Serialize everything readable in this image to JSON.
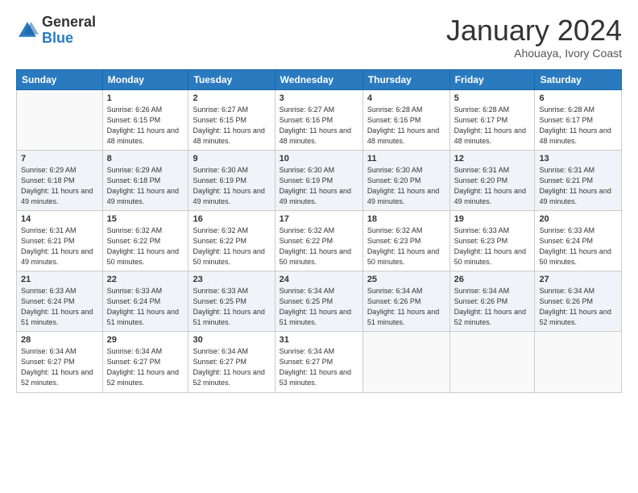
{
  "logo": {
    "general": "General",
    "blue": "Blue"
  },
  "title": "January 2024",
  "subtitle": "Ahouaya, Ivory Coast",
  "weekdays": [
    "Sunday",
    "Monday",
    "Tuesday",
    "Wednesday",
    "Thursday",
    "Friday",
    "Saturday"
  ],
  "weeks": [
    [
      {
        "day": null
      },
      {
        "day": "1",
        "sunrise": "6:26 AM",
        "sunset": "6:15 PM",
        "daylight": "11 hours and 48 minutes."
      },
      {
        "day": "2",
        "sunrise": "6:27 AM",
        "sunset": "6:15 PM",
        "daylight": "11 hours and 48 minutes."
      },
      {
        "day": "3",
        "sunrise": "6:27 AM",
        "sunset": "6:16 PM",
        "daylight": "11 hours and 48 minutes."
      },
      {
        "day": "4",
        "sunrise": "6:28 AM",
        "sunset": "6:16 PM",
        "daylight": "11 hours and 48 minutes."
      },
      {
        "day": "5",
        "sunrise": "6:28 AM",
        "sunset": "6:17 PM",
        "daylight": "11 hours and 48 minutes."
      },
      {
        "day": "6",
        "sunrise": "6:28 AM",
        "sunset": "6:17 PM",
        "daylight": "11 hours and 48 minutes."
      }
    ],
    [
      {
        "day": "7",
        "sunrise": "6:29 AM",
        "sunset": "6:18 PM",
        "daylight": "11 hours and 49 minutes."
      },
      {
        "day": "8",
        "sunrise": "6:29 AM",
        "sunset": "6:18 PM",
        "daylight": "11 hours and 49 minutes."
      },
      {
        "day": "9",
        "sunrise": "6:30 AM",
        "sunset": "6:19 PM",
        "daylight": "11 hours and 49 minutes."
      },
      {
        "day": "10",
        "sunrise": "6:30 AM",
        "sunset": "6:19 PM",
        "daylight": "11 hours and 49 minutes."
      },
      {
        "day": "11",
        "sunrise": "6:30 AM",
        "sunset": "6:20 PM",
        "daylight": "11 hours and 49 minutes."
      },
      {
        "day": "12",
        "sunrise": "6:31 AM",
        "sunset": "6:20 PM",
        "daylight": "11 hours and 49 minutes."
      },
      {
        "day": "13",
        "sunrise": "6:31 AM",
        "sunset": "6:21 PM",
        "daylight": "11 hours and 49 minutes."
      }
    ],
    [
      {
        "day": "14",
        "sunrise": "6:31 AM",
        "sunset": "6:21 PM",
        "daylight": "11 hours and 49 minutes."
      },
      {
        "day": "15",
        "sunrise": "6:32 AM",
        "sunset": "6:22 PM",
        "daylight": "11 hours and 50 minutes."
      },
      {
        "day": "16",
        "sunrise": "6:32 AM",
        "sunset": "6:22 PM",
        "daylight": "11 hours and 50 minutes."
      },
      {
        "day": "17",
        "sunrise": "6:32 AM",
        "sunset": "6:22 PM",
        "daylight": "11 hours and 50 minutes."
      },
      {
        "day": "18",
        "sunrise": "6:32 AM",
        "sunset": "6:23 PM",
        "daylight": "11 hours and 50 minutes."
      },
      {
        "day": "19",
        "sunrise": "6:33 AM",
        "sunset": "6:23 PM",
        "daylight": "11 hours and 50 minutes."
      },
      {
        "day": "20",
        "sunrise": "6:33 AM",
        "sunset": "6:24 PM",
        "daylight": "11 hours and 50 minutes."
      }
    ],
    [
      {
        "day": "21",
        "sunrise": "6:33 AM",
        "sunset": "6:24 PM",
        "daylight": "11 hours and 51 minutes."
      },
      {
        "day": "22",
        "sunrise": "6:33 AM",
        "sunset": "6:24 PM",
        "daylight": "11 hours and 51 minutes."
      },
      {
        "day": "23",
        "sunrise": "6:33 AM",
        "sunset": "6:25 PM",
        "daylight": "11 hours and 51 minutes."
      },
      {
        "day": "24",
        "sunrise": "6:34 AM",
        "sunset": "6:25 PM",
        "daylight": "11 hours and 51 minutes."
      },
      {
        "day": "25",
        "sunrise": "6:34 AM",
        "sunset": "6:26 PM",
        "daylight": "11 hours and 51 minutes."
      },
      {
        "day": "26",
        "sunrise": "6:34 AM",
        "sunset": "6:26 PM",
        "daylight": "11 hours and 52 minutes."
      },
      {
        "day": "27",
        "sunrise": "6:34 AM",
        "sunset": "6:26 PM",
        "daylight": "11 hours and 52 minutes."
      }
    ],
    [
      {
        "day": "28",
        "sunrise": "6:34 AM",
        "sunset": "6:27 PM",
        "daylight": "11 hours and 52 minutes."
      },
      {
        "day": "29",
        "sunrise": "6:34 AM",
        "sunset": "6:27 PM",
        "daylight": "11 hours and 52 minutes."
      },
      {
        "day": "30",
        "sunrise": "6:34 AM",
        "sunset": "6:27 PM",
        "daylight": "11 hours and 52 minutes."
      },
      {
        "day": "31",
        "sunrise": "6:34 AM",
        "sunset": "6:27 PM",
        "daylight": "11 hours and 53 minutes."
      },
      {
        "day": null
      },
      {
        "day": null
      },
      {
        "day": null
      }
    ]
  ]
}
